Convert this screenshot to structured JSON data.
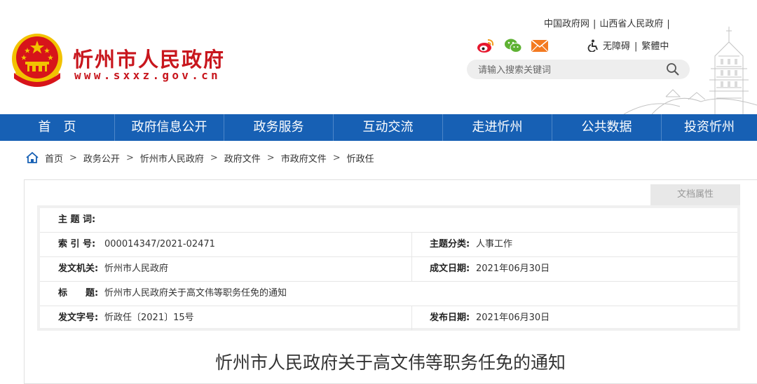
{
  "header": {
    "site_title": "忻州市人民政府",
    "site_url": "www.sxxz.gov.cn",
    "top_links": [
      "中国政府网",
      "山西省人民政府"
    ],
    "accessibility_label": "无障碍",
    "traditional_label": "繁體中",
    "search_placeholder": "请输入搜索关键词"
  },
  "nav": {
    "items": [
      "首　页",
      "政府信息公开",
      "政务服务",
      "互动交流",
      "走进忻州",
      "公共数据",
      "投资忻州"
    ]
  },
  "breadcrumb": {
    "items": [
      "首页",
      "政务公开",
      "忻州市人民政府",
      "政府文件",
      "市政府文件",
      "忻政任"
    ]
  },
  "doc_attr_tab": "文档属性",
  "meta": {
    "subject_words_label": "主 题 词:",
    "subject_words_value": "",
    "index_label": "索 引 号:",
    "index_value": "000014347/2021-02471",
    "category_label": "主题分类:",
    "category_value": "人事工作",
    "issuer_label": "发文机关:",
    "issuer_value": "忻州市人民政府",
    "created_label": "成文日期:",
    "created_value": "2021年06月30日",
    "title_label": "标　　题:",
    "title_value": "忻州市人民政府关于高文伟等职务任免的通知",
    "docno_label": "发文字号:",
    "docno_value": "忻政任〔2021〕15号",
    "published_label": "发布日期:",
    "published_value": "2021年06月30日"
  },
  "document_title": "忻州市人民政府关于高文伟等职务任免的通知",
  "colors": {
    "brand_red": "#c8161d",
    "nav_blue": "#1760b4",
    "emblem_gold": "#f2c200"
  }
}
